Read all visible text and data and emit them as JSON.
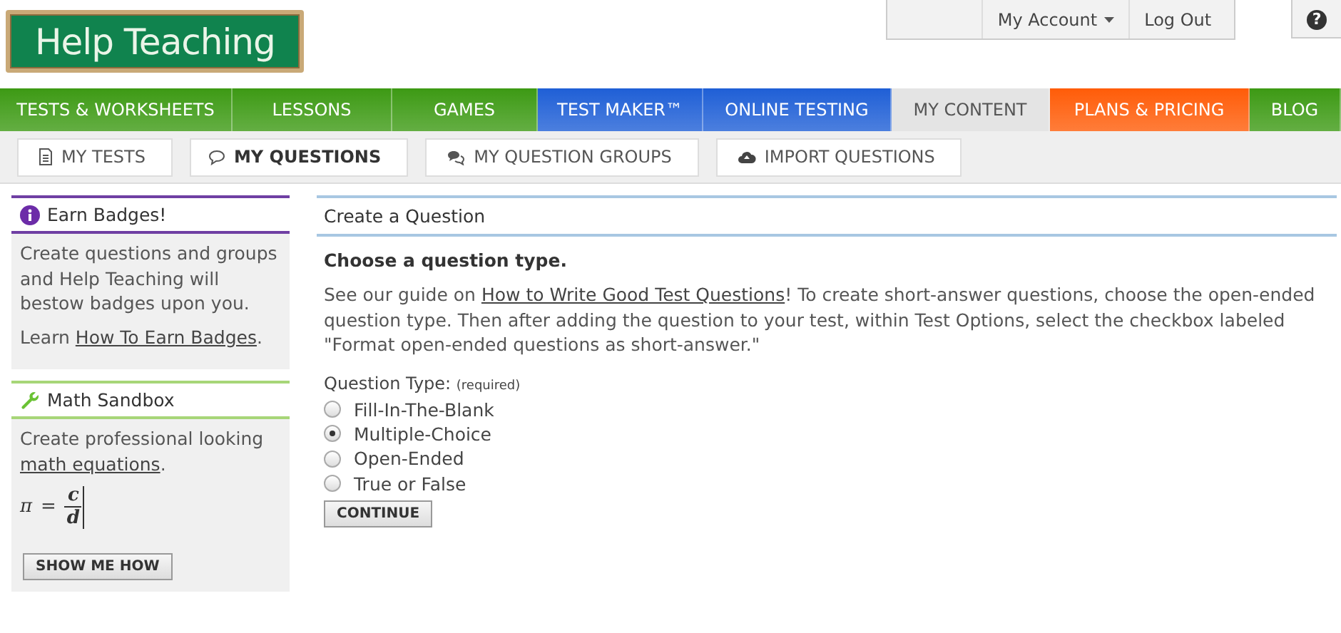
{
  "logo": {
    "text": "Help Teaching"
  },
  "account_bar": {
    "items": [
      {
        "label": "My Account",
        "kind": "dropdown"
      },
      {
        "label": "Log Out",
        "kind": "link"
      }
    ],
    "help": "?"
  },
  "nav": [
    {
      "label": "TESTS & WORKSHEETS",
      "color": "#3d9a14",
      "selected": false
    },
    {
      "label": "LESSONS",
      "color": "#3d9a14",
      "selected": false
    },
    {
      "label": "GAMES",
      "color": "#3d9a14",
      "selected": false
    },
    {
      "label": "TEST MAKER™",
      "color": "#1f5fd6",
      "selected": false
    },
    {
      "label": "ONLINE TESTING",
      "color": "#1f5fd6",
      "selected": false
    },
    {
      "label": "MY CONTENT",
      "color": "#e4e4e4",
      "selected": true
    },
    {
      "label": "PLANS & PRICING",
      "color": "#ff5c08",
      "selected": false
    },
    {
      "label": "BLOG",
      "color": "#3d9a14",
      "selected": false
    }
  ],
  "subnav": [
    {
      "label": "MY TESTS",
      "kind": "document",
      "selected": false
    },
    {
      "label": "MY QUESTIONS",
      "kind": "bubble",
      "selected": true
    },
    {
      "label": "MY QUESTION GROUPS",
      "kind": "bubbles",
      "selected": false
    },
    {
      "label": "IMPORT QUESTIONS",
      "kind": "cloud",
      "selected": false
    }
  ],
  "sidebar": [
    {
      "kind": "badges",
      "title": "Earn Badges!",
      "text": "Create questions and groups and Help Teaching will bestow badges upon you.",
      "link_prefix": "Learn",
      "link": "How To Earn Badges",
      "link_suffix": "."
    },
    {
      "kind": "math",
      "title": "Math Sandbox",
      "text": "Create professional looking",
      "link": "math equations",
      "link_suffix": ".",
      "equation": {
        "lhs": "π",
        "op": "=",
        "numerator": "c",
        "denominator": "d"
      },
      "button": "SHOW ME HOW"
    }
  ],
  "main": {
    "title": "Create a Question",
    "heading": "Choose a question type.",
    "intro_prefix": "See our guide on",
    "intro_link": "How to Write Good Test Questions",
    "intro_rest": "! To create short-answer questions, choose the open-ended question type. Then after adding the question to your test, within Test Options, select the checkbox labeled \"Format open-ended questions as short-answer.\"",
    "question_type_label": "Question Type:",
    "required_note": "(required)",
    "options": [
      {
        "label": "Fill-In-The-Blank",
        "selected": false
      },
      {
        "label": "Multiple-Choice",
        "selected": true
      },
      {
        "label": "Open-Ended",
        "selected": false
      },
      {
        "label": "True or False",
        "selected": false
      }
    ],
    "button": "CONTINUE"
  }
}
